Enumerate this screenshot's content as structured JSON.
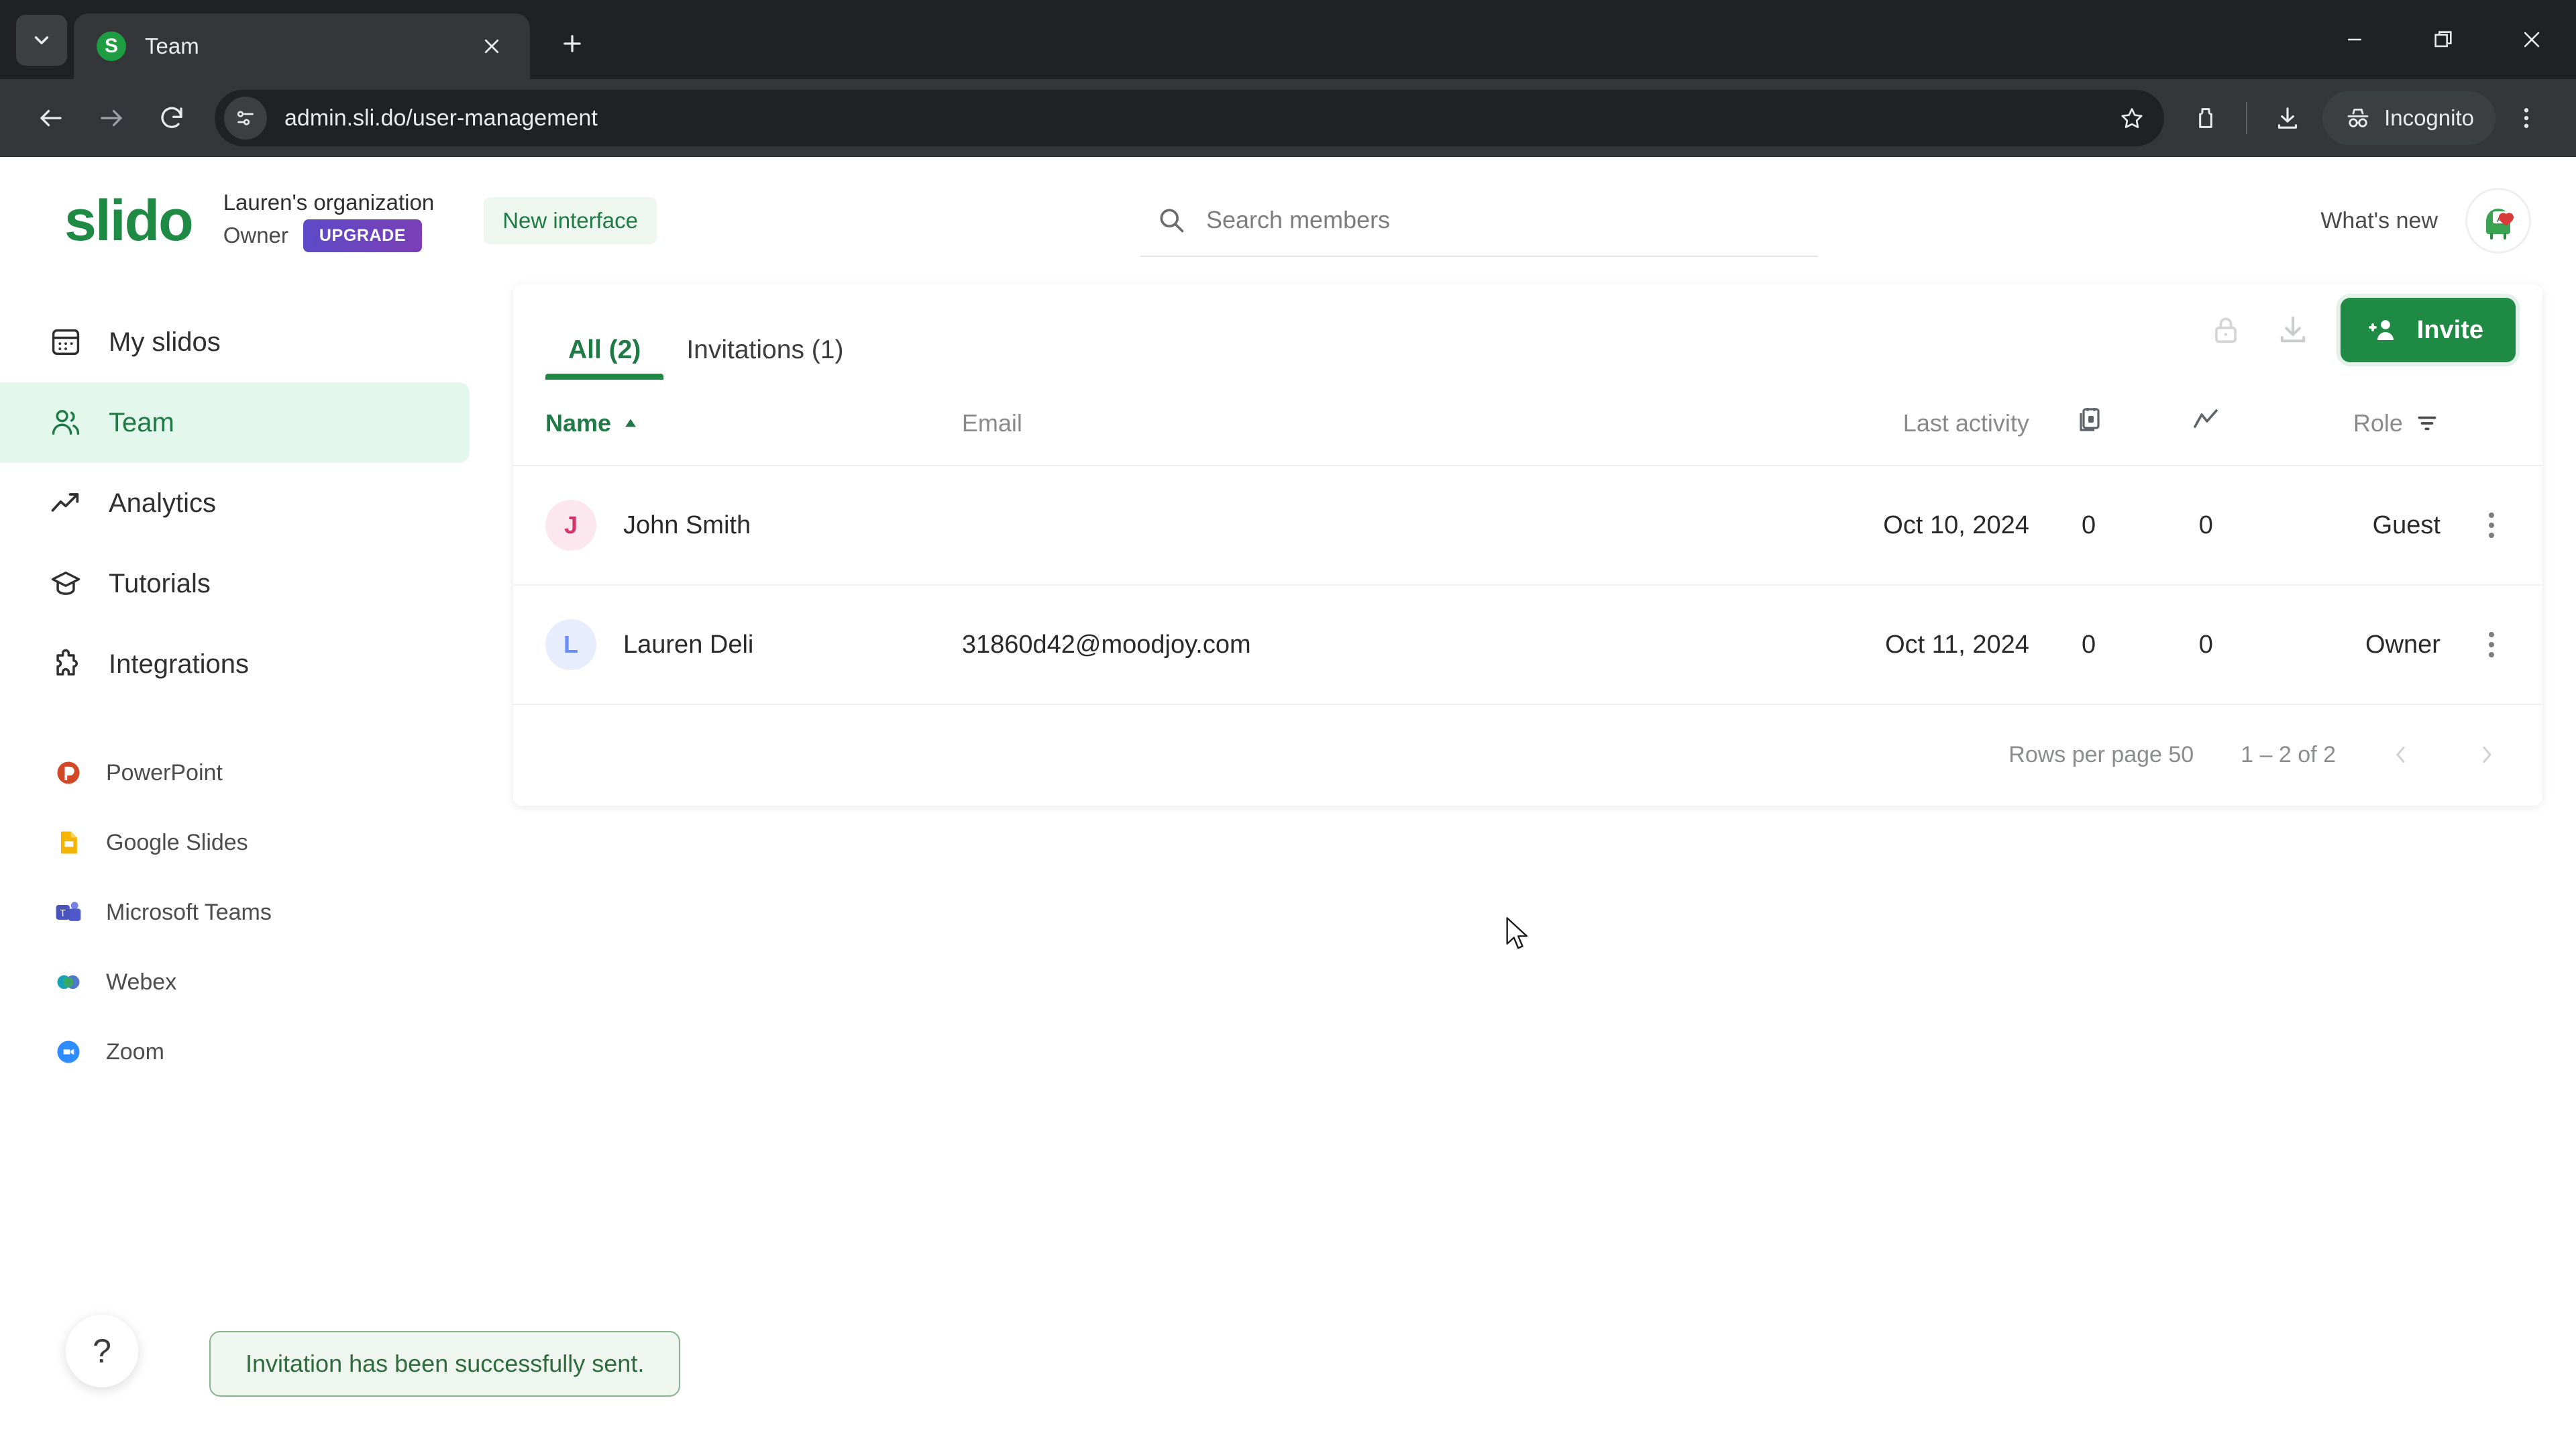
{
  "browser": {
    "tab": {
      "title": "Team",
      "favicon_letter": "S"
    },
    "icons": {
      "tab_search": "chevron-down-icon",
      "tab_close": "close-icon",
      "new_tab": "plus-icon",
      "back": "back-arrow-icon",
      "forward": "forward-arrow-icon",
      "reload": "reload-icon",
      "site_info": "site-settings-icon",
      "bookmark": "star-icon",
      "extensions": "extensions-icon",
      "downloads": "download-icon",
      "menu": "three-dot-menu-icon",
      "minimize": "minimize-icon",
      "maximize": "maximize-icon",
      "close_window": "window-close-icon"
    },
    "url": "admin.sli.do/user-management",
    "profile_label": "Incognito"
  },
  "header": {
    "logo": "slido",
    "org_name": "Lauren's organization",
    "org_role": "Owner",
    "upgrade_label": "UPGRADE",
    "new_interface_label": "New interface",
    "search": {
      "placeholder": "Search members",
      "value": "",
      "icon": "search-icon"
    },
    "whats_new_label": "What's new",
    "avatar": "user-avatar"
  },
  "sidebar": {
    "items": [
      {
        "label": "My slidos",
        "icon": "slides-grid-icon",
        "active": false
      },
      {
        "label": "Team",
        "icon": "people-icon",
        "active": true
      },
      {
        "label": "Analytics",
        "icon": "trend-up-icon",
        "active": false
      },
      {
        "label": "Tutorials",
        "icon": "graduation-cap-icon",
        "active": false
      },
      {
        "label": "Integrations",
        "icon": "puzzle-piece-icon",
        "active": false
      }
    ],
    "integrations": [
      {
        "label": "PowerPoint",
        "icon": "powerpoint-icon",
        "color": "#d24726"
      },
      {
        "label": "Google Slides",
        "icon": "google-slides-icon",
        "color": "#f4b400"
      },
      {
        "label": "Microsoft Teams",
        "icon": "microsoft-teams-icon",
        "color": "#5059c9"
      },
      {
        "label": "Webex",
        "icon": "webex-icon",
        "color": "#17a2b8"
      },
      {
        "label": "Zoom",
        "icon": "zoom-icon",
        "color": "#2d8cff"
      }
    ],
    "help_label": "?"
  },
  "main": {
    "tabs": [
      {
        "label": "All (2)",
        "active": true
      },
      {
        "label": "Invitations (1)",
        "active": false
      }
    ],
    "actions": {
      "lock_icon": "lock-icon",
      "export_icon": "download-icon",
      "invite_label": "Invite",
      "invite_icon": "add-person-icon"
    },
    "table": {
      "columns": [
        {
          "key": "name",
          "label": "Name",
          "sort": "asc",
          "sort_icon": "caret-up-icon"
        },
        {
          "key": "email",
          "label": "Email"
        },
        {
          "key": "last_activity",
          "label": "Last activity"
        },
        {
          "key": "events",
          "label": "",
          "icon": "events-icon"
        },
        {
          "key": "participants",
          "label": "",
          "icon": "trend-line-icon"
        },
        {
          "key": "role",
          "label": "Role",
          "filter_icon": "filter-icon"
        },
        {
          "key": "menu",
          "label": ""
        }
      ],
      "rows": [
        {
          "initial": "J",
          "initial_color": "#d6336c",
          "initial_bg": "#fce7ef",
          "name": "John Smith",
          "email": "",
          "last_activity": "Oct 10, 2024",
          "events": "0",
          "participants": "0",
          "role": "Guest",
          "menu_icon": "kebab-menu-icon"
        },
        {
          "initial": "L",
          "initial_color": "#6b8ff5",
          "initial_bg": "#e8edfd",
          "name": "Lauren Deli",
          "email": "31860d42@moodjoy.com",
          "last_activity": "Oct 11, 2024",
          "events": "0",
          "participants": "0",
          "role": "Owner",
          "menu_icon": "kebab-menu-icon"
        }
      ]
    },
    "pager": {
      "rows_per_page_label": "Rows per page 50",
      "range_label": "1 – 2 of 2",
      "prev_icon": "chevron-left-icon",
      "next_icon": "chevron-right-icon"
    }
  },
  "toast": {
    "message": "Invitation has been successfully sent."
  },
  "colors": {
    "brand_green": "#1f8a43",
    "active_nav_bg": "#e3f7ec",
    "toast_bg": "#eef6ef",
    "toast_border": "#8ab38f",
    "upgrade_gradient_from": "#5c4ac7",
    "upgrade_gradient_to": "#7b3fb5"
  }
}
